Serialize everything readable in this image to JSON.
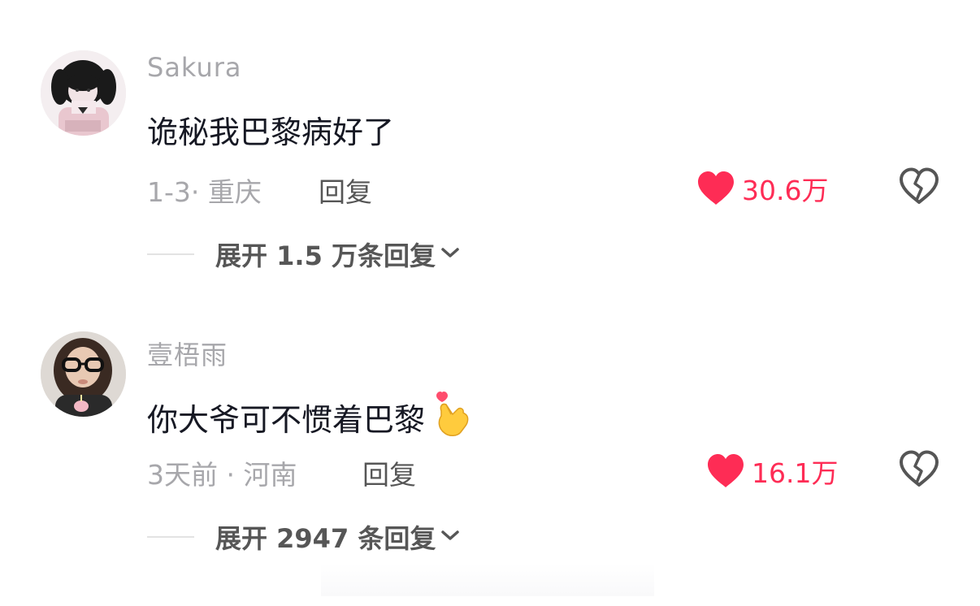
{
  "comments": [
    {
      "username": "Sakura",
      "text": "诡秘我巴黎病好了",
      "emoji": "",
      "date": "1-3·",
      "location": "重庆",
      "reply_label": "回复",
      "likes": "30.6万",
      "expand_label": "展开 1.5 万条回复",
      "like_color": "#fe2c55",
      "avatar_icon": "anime-girl-avatar"
    },
    {
      "username": "壹梧雨",
      "text": "你大爷可不惯着巴黎",
      "emoji": "🫰",
      "date": "3天前 ·",
      "location": "河南",
      "reply_label": "回复",
      "likes": "16.1万",
      "expand_label": "展开 2947 条回复",
      "like_color": "#fe2c55",
      "avatar_icon": "girl-with-glasses-avatar"
    }
  ]
}
